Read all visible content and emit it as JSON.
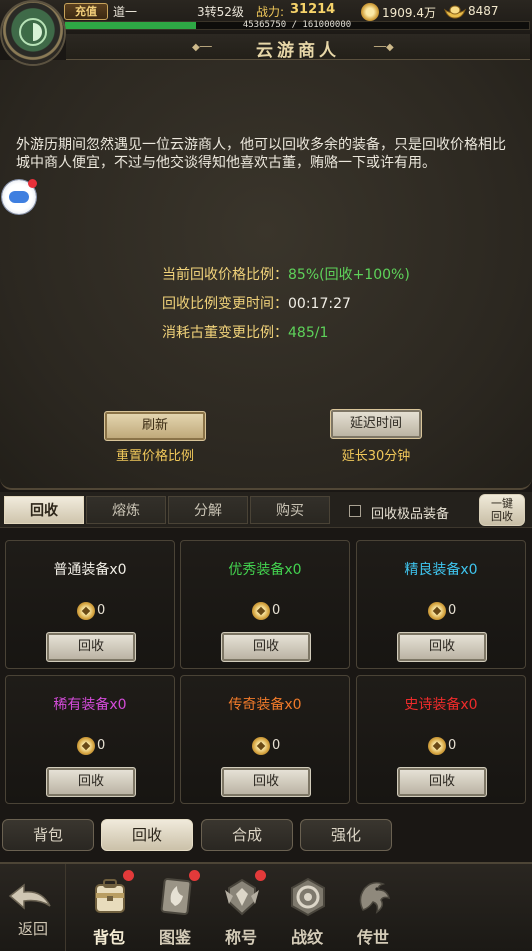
{
  "top": {
    "charge_label": "充值",
    "player_name": "道一",
    "level": "3转52级",
    "power_label": "战力:",
    "power_value": "31214",
    "xp_text": "45365750 / 161000000",
    "xp_progress": 0.282,
    "gold": "1909.4万",
    "ingot": "8487"
  },
  "title": "云游商人",
  "description": "外游历期间忽然遇见一位云游商人，他可以回收多余的装备，只是回收价格相比城中商人便宜，不过与他交谈得知他喜欢古董，贿赂一下或许有用。",
  "info": {
    "price_ratio_label": "当前回收价格比例：",
    "price_ratio_value": "85%(回收+100%)",
    "change_time_label": "回收比例变更时间：",
    "change_time_value": "00:17:27",
    "antique_label": "消耗古董变更比例：",
    "antique_value": "485/1"
  },
  "actions": {
    "refresh_label": "刷新",
    "refresh_sub": "重置价格比例",
    "delay_label": "延迟时间",
    "delay_sub": "延长30分钟"
  },
  "tabs": [
    "回收",
    "熔炼",
    "分解",
    "购买"
  ],
  "checkbox_label": "回收极品装备",
  "one_key_line1": "一键",
  "one_key_line2": "回收",
  "grid": [
    {
      "name": "普通装备x0",
      "color": "#f1eee6",
      "count": "0",
      "button": "回收"
    },
    {
      "name": "优秀装备x0",
      "color": "#43d24f",
      "count": "0",
      "button": "回收"
    },
    {
      "name": "精良装备x0",
      "color": "#3fc4ee",
      "count": "0",
      "button": "回收"
    },
    {
      "name": "稀有装备x0",
      "color": "#d34bd8",
      "count": "0",
      "button": "回收"
    },
    {
      "name": "传奇装备x0",
      "color": "#f07a2a",
      "count": "0",
      "button": "回收"
    },
    {
      "name": "史诗装备x0",
      "color": "#ee2b2b",
      "count": "0",
      "button": "回收"
    }
  ],
  "subtabs": [
    "背包",
    "回收",
    "合成",
    "强化"
  ],
  "bottom_nav": {
    "back_label": "返回",
    "items": [
      {
        "label": "背包",
        "icon": "backpack-icon",
        "badge": true
      },
      {
        "label": "图鉴",
        "icon": "book-icon",
        "badge": true
      },
      {
        "label": "称号",
        "icon": "title-emblem-icon",
        "badge": true
      },
      {
        "label": "战纹",
        "icon": "war-pattern-icon",
        "badge": false
      },
      {
        "label": "传世",
        "icon": "dragon-icon",
        "badge": false
      }
    ]
  },
  "colors": {
    "accent_gold": "#f0c85a",
    "value_green": "#5ed25a",
    "xp_green": "#2ea845"
  }
}
